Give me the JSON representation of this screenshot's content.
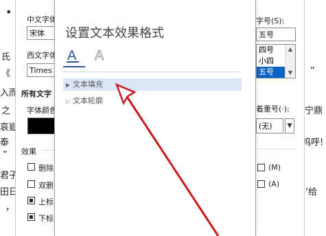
{
  "document": {
    "left_lines": [
      "氏",
      "《",
      "入而",
      "之",
      "哀嶽",
      "泰",
      "”",
      "君子",
      "田日",
      "，"
    ],
    "right_lines": [
      "”",
      "宁鼎",
      "呜呼!",
      "‘给"
    ],
    "top_bullet": "•"
  },
  "font_dialog": {
    "cn_font_label": "中文字体",
    "cn_font_value": "宋体",
    "west_font_label": "西文字体",
    "west_font_value": "Times",
    "all_text_label": "所有文字",
    "font_color_label": "字体颜色",
    "effects_label": "效果",
    "size_label": "字号(S):",
    "size_value": "五号",
    "size_list": [
      "四号",
      "小四",
      "五号"
    ],
    "emphasis_label": "着重号(·):",
    "emphasis_value": "(无)",
    "checkboxes": [
      {
        "label": "删除",
        "checked": false
      },
      {
        "label": "双删",
        "checked": false
      },
      {
        "label": "上标",
        "checked": true
      },
      {
        "label": "下标",
        "checked": true
      }
    ],
    "right_opts": [
      {
        "label": "(M)",
        "checked": false
      },
      {
        "label": "(A)",
        "checked": false
      }
    ],
    "help_btn": "?",
    "close_btn": "✕"
  },
  "pane": {
    "title": "设置文本效果格式",
    "tab_fill_letter": "A",
    "tab_effect_letter": "A",
    "sections": [
      "文本填充",
      "文本轮廓"
    ]
  },
  "colors": {
    "accent": "#2b579a",
    "highlight": "#dbe7f6",
    "arrow": "#c8191e",
    "selection": "#0a64c8"
  }
}
